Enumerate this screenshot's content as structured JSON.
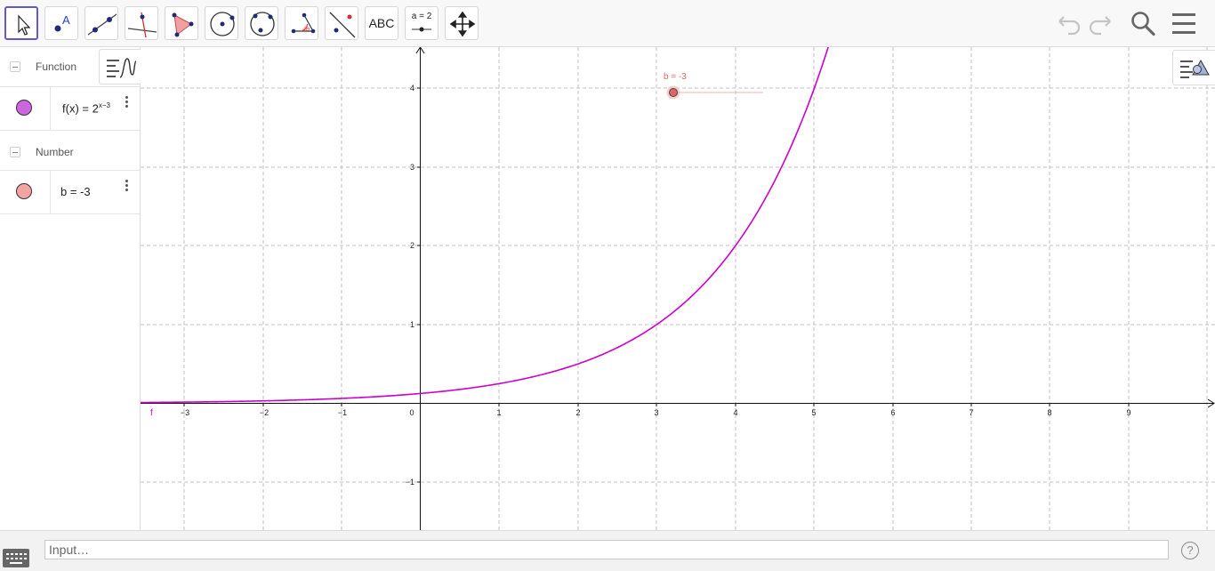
{
  "toolbar": {
    "tools": [
      {
        "name": "move-tool",
        "icon": "cursor-arrow-icon",
        "active": true
      },
      {
        "name": "point-tool",
        "icon": "point-A-icon"
      },
      {
        "name": "line-tool",
        "icon": "line-through-points-icon"
      },
      {
        "name": "perpendicular-line-tool",
        "icon": "perpendicular-line-icon"
      },
      {
        "name": "polygon-tool",
        "icon": "polygon-icon"
      },
      {
        "name": "circle-center-point-tool",
        "icon": "circle-center-point-icon"
      },
      {
        "name": "circle-three-points-tool",
        "icon": "circle-three-points-icon"
      },
      {
        "name": "angle-tool",
        "icon": "angle-icon"
      },
      {
        "name": "reflect-tool",
        "icon": "reflect-about-line-icon"
      },
      {
        "name": "text-tool",
        "icon": "text-icon",
        "label": "ABC"
      },
      {
        "name": "slider-tool",
        "icon": "slider-icon",
        "label": "a = 2"
      },
      {
        "name": "move-graphics-view-tool",
        "icon": "move-arrows-icon"
      }
    ],
    "right": {
      "undo": "undo-icon",
      "redo": "redo-icon",
      "search": "search-icon",
      "menu": "hamburger-menu-icon"
    }
  },
  "algebra": {
    "groups": [
      {
        "label": "Function",
        "items": [
          {
            "lhs": "f(x)",
            "eq": " = ",
            "base": "2",
            "exponent": "x−3",
            "color": "#cc66dd"
          }
        ]
      },
      {
        "label": "Number",
        "items": [
          {
            "text": "b = -3",
            "color": "#f4a3a3"
          }
        ]
      }
    ]
  },
  "graphics": {
    "function_label": "f",
    "function_color": "#cc00cc",
    "slider": {
      "label": "b = -3",
      "value": -3,
      "color": "#e06666"
    },
    "x_ticks": [
      "−3",
      "−2",
      "−1",
      "0",
      "1",
      "2",
      "3",
      "4",
      "5",
      "6",
      "7",
      "8",
      "9"
    ],
    "y_ticks": [
      "−1",
      "1",
      "2",
      "3",
      "4"
    ]
  },
  "input": {
    "placeholder": "Input…"
  },
  "help": "?"
}
